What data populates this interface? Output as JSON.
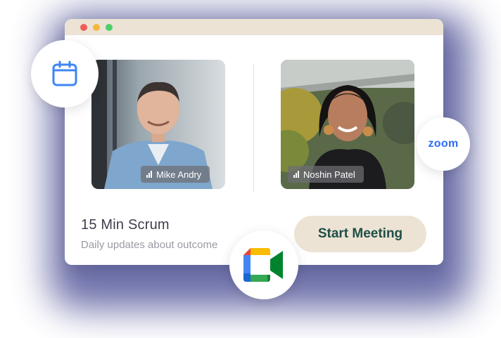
{
  "window": {
    "controls": [
      "close",
      "minimize",
      "maximize"
    ]
  },
  "participants": [
    {
      "name": "Mike Andry",
      "signal_icon": "signal-bars-icon"
    },
    {
      "name": "Noshin Patel",
      "signal_icon": "signal-bars-icon"
    }
  ],
  "meeting": {
    "title": "15 Min Scrum",
    "subtitle": "Daily updates about outcome",
    "start_label": "Start Meeting"
  },
  "integrations": {
    "calendar_icon": "calendar-icon",
    "zoom_label": "zoom",
    "meet_icon": "google-meet-icon"
  },
  "colors": {
    "titlebar": "#ece3d4",
    "button_bg": "#ece3d4",
    "button_text": "#1f4f48",
    "glow": "#3b3f8c",
    "zoom_blue": "#2d6df6"
  }
}
